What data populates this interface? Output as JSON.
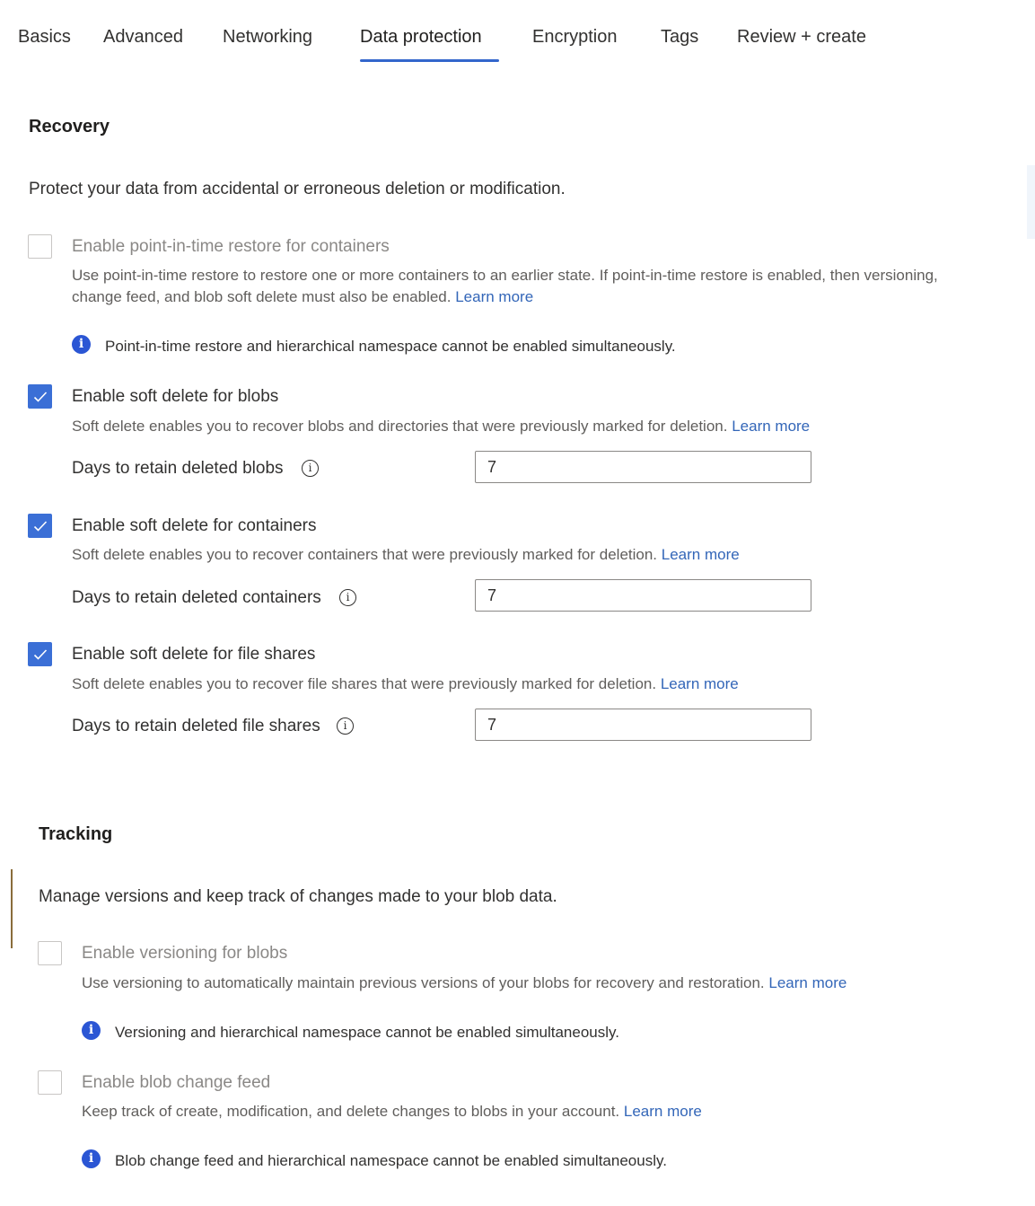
{
  "tabs": [
    {
      "label": "Basics",
      "active": false
    },
    {
      "label": "Advanced",
      "active": false
    },
    {
      "label": "Networking",
      "active": false
    },
    {
      "label": "Data protection",
      "active": true
    },
    {
      "label": "Encryption",
      "active": false
    },
    {
      "label": "Tags",
      "active": false
    },
    {
      "label": "Review + create",
      "active": false
    }
  ],
  "recovery": {
    "title": "Recovery",
    "description": "Protect your data from accidental or erroneous deletion or modification.",
    "pitr": {
      "label": "Enable point-in-time restore for containers",
      "checked": false,
      "disabled": true,
      "help_line1": "Use point-in-time restore to restore one or more containers to an earlier state. If point-in-time restore is enabled, then versioning,",
      "help_line2": "change feed, and blob soft delete must also be enabled.",
      "link": "Learn more",
      "info": "Point-in-time restore and hierarchical namespace cannot be enabled simultaneously."
    },
    "soft_delete_blobs": {
      "label": "Enable soft delete for blobs",
      "checked": true,
      "help": "Soft delete enables you to recover blobs and directories that were previously marked for deletion.",
      "link": "Learn more",
      "field_label": "Days to retain deleted blobs",
      "value": "7"
    },
    "soft_delete_containers": {
      "label": "Enable soft delete for containers",
      "checked": true,
      "help": "Soft delete enables you to recover containers that were previously marked for deletion.",
      "link": "Learn more",
      "field_label": "Days to retain deleted containers",
      "value": "7"
    },
    "soft_delete_shares": {
      "label": "Enable soft delete for file shares",
      "checked": true,
      "help": "Soft delete enables you to recover file shares that were previously marked for deletion.",
      "link": "Learn more",
      "field_label": "Days to retain deleted file shares",
      "value": "7"
    }
  },
  "tracking": {
    "title": "Tracking",
    "description": "Manage versions and keep track of changes made to your blob data.",
    "versioning": {
      "label": "Enable versioning for blobs",
      "checked": false,
      "disabled": true,
      "help": "Use versioning to automatically maintain previous versions of your blobs for recovery and restoration.",
      "link": "Learn more",
      "info": "Versioning and hierarchical namespace cannot be enabled simultaneously."
    },
    "change_feed": {
      "label": "Enable blob change feed",
      "checked": false,
      "disabled": true,
      "help": "Keep track of create, modification, and delete changes to blobs in your account.",
      "link": "Learn more",
      "info": "Blob change feed and hierarchical namespace cannot be enabled simultaneously."
    }
  },
  "icons": {
    "info": "i",
    "tooltip": "i"
  }
}
